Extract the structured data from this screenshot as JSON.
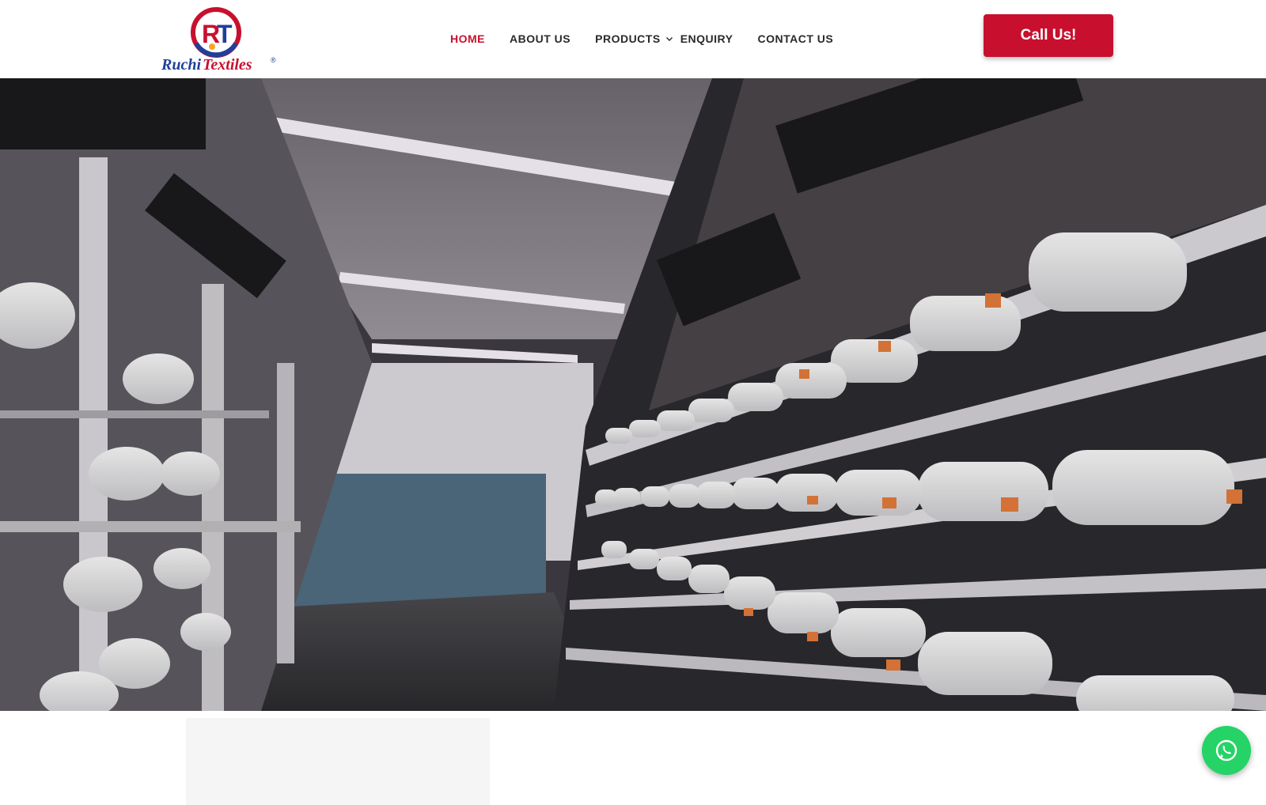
{
  "brand": {
    "logo_monogram": "RT",
    "logo_name": "Ruchi Textiles",
    "registered_mark": "®",
    "primary_color": "#c8102e",
    "logo_blue": "#1f3f9a"
  },
  "nav": {
    "items": [
      {
        "label": "HOME",
        "active": true
      },
      {
        "label": "ABOUT US",
        "active": false
      },
      {
        "label": "PRODUCTS",
        "active": false,
        "has_dropdown": true
      },
      {
        "label": "ENQUIRY",
        "active": false
      },
      {
        "label": "CONTACT US",
        "active": false
      }
    ]
  },
  "header": {
    "cta_label": "Call Us!"
  },
  "hero": {
    "image_subject": "textile yarn winding machines with white spools"
  },
  "floating": {
    "whatsapp_icon": "whatsapp-icon",
    "whatsapp_color": "#25d366"
  }
}
